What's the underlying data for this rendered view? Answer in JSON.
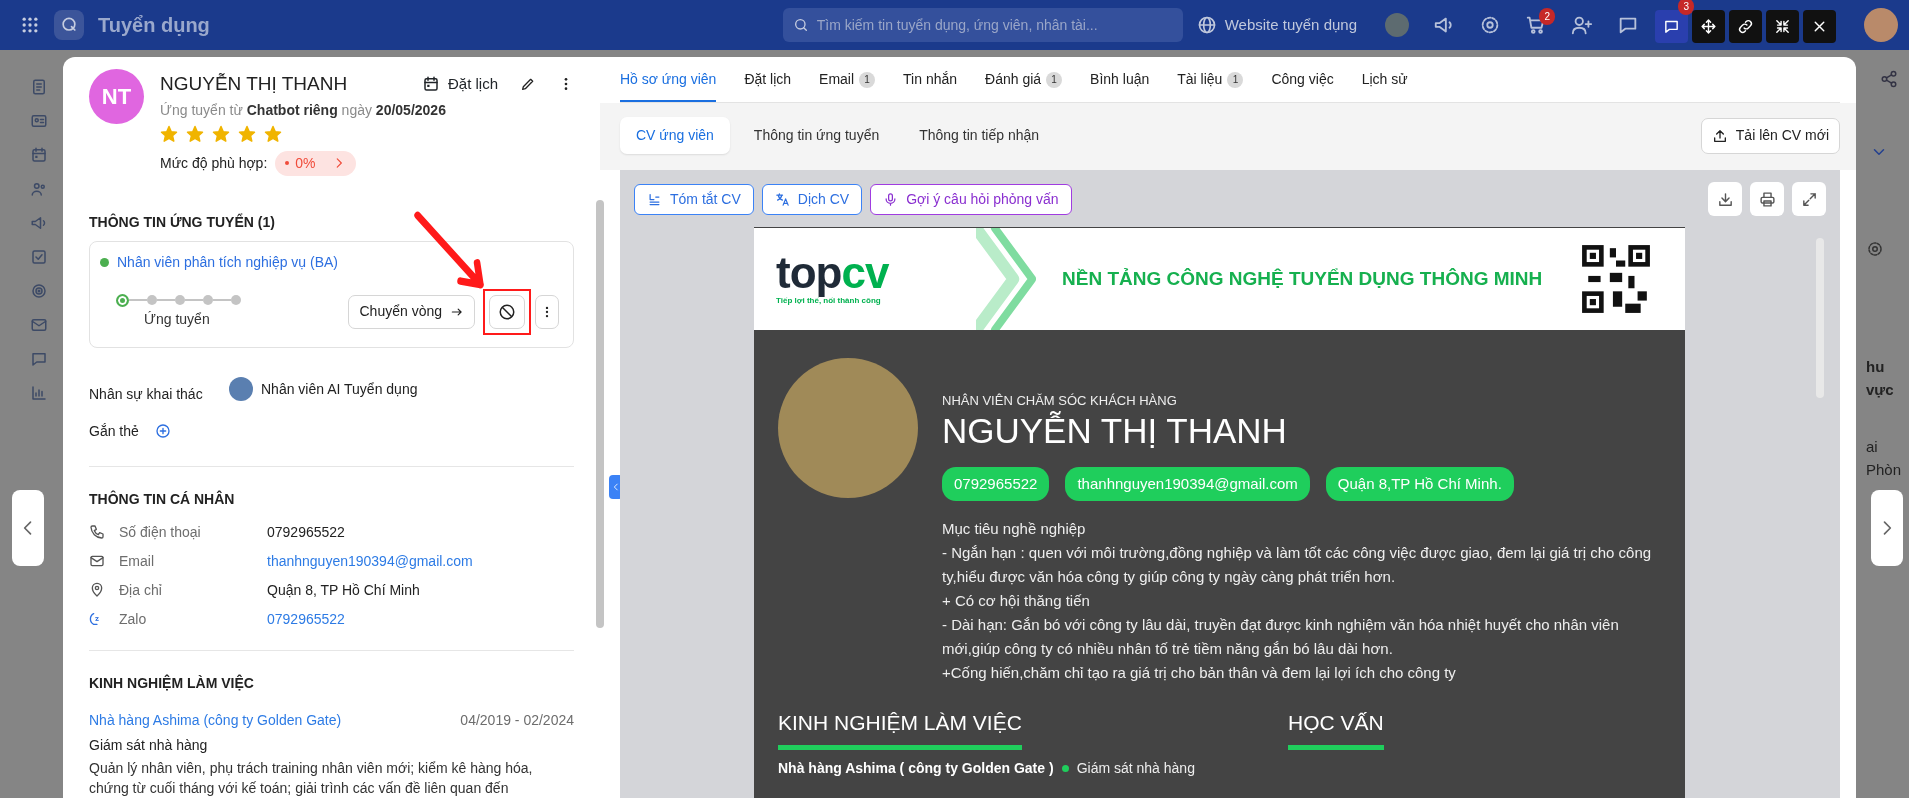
{
  "topbar": {
    "app_title": "Tuyển dụng",
    "search": {
      "placeholder": "Tìm kiếm tin tuyển dụng, ứng viên, nhân tài..."
    },
    "website_link": "Website tuyển dụng",
    "cart_badge": "2"
  },
  "modal_toolbar": {
    "chat_badge": "3"
  },
  "background": {
    "column_header": "hu vực",
    "cell": "ai Phòn"
  },
  "candidate": {
    "initials": "NT",
    "name": "NGUYỄN THỊ THANH",
    "schedule_button": "Đặt lịch",
    "source": "Ứng tuyển từ **Chatbot riêng** ngày **20/05/2026**",
    "stars": 5,
    "match_label": "Mức độ phù hợp:",
    "match_value": "0%"
  },
  "application": {
    "title": "THÔNG TIN ỨNG TUYỂN (1)",
    "job": {
      "title": "Nhân viên phân tích nghiệp vụ (BA)",
      "color": "#4caf50"
    },
    "stages": [
      {
        "selected": true
      },
      {
        "selected": false
      },
      {
        "selected": false
      },
      {
        "selected": false
      },
      {
        "selected": false
      }
    ],
    "current_stage": "Ứng tuyển",
    "move_button": "Chuyển vòng",
    "owner_label": "Nhân sự khai thác",
    "owner_name": "Nhân viên AI Tuyển dụng",
    "tag_label": "Gắn thẻ"
  },
  "personal": {
    "title": "THÔNG TIN CÁ NHÂN",
    "fields": [
      {
        "kind": "phone",
        "label": "Số điện thoại",
        "value": "0792965522",
        "link": false
      },
      {
        "kind": "email",
        "label": "Email",
        "value": "thanhnguyen190394@gmail.com",
        "link": true
      },
      {
        "kind": "address",
        "label": "Địa chỉ",
        "value": "Quận 8, TP Hồ Chí Minh",
        "link": false
      },
      {
        "kind": "zalo",
        "label": "Zalo",
        "value": "0792965522",
        "link": true
      }
    ]
  },
  "experience": {
    "title": "KINH NGHIỆM LÀM VIỆC",
    "items": [
      {
        "company": "Nhà hàng Ashima (công ty Golden Gate)",
        "period": "04/2019 - 02/2024",
        "role": "Giám sát nhà hàng",
        "description": "Quản lý nhân viên, phụ trách training nhân viên mới; kiểm kê hàng hóa, chứng từ cuối tháng với kế toán; giải trình các vấn đề liên quan đến"
      }
    ]
  },
  "tabs": [
    {
      "label": "Hồ sơ ứng viên",
      "selected": true
    },
    {
      "label": "Đặt lịch",
      "selected": false
    },
    {
      "label": "Email",
      "count": "1",
      "selected": false
    },
    {
      "label": "Tin nhắn",
      "selected": false
    },
    {
      "label": "Đánh giá",
      "count": "1",
      "selected": false
    },
    {
      "label": "Bình luận",
      "selected": false
    },
    {
      "label": "Tài liệu",
      "count": "1",
      "selected": false
    },
    {
      "label": "Công việc",
      "selected": false
    },
    {
      "label": "Lịch sử",
      "selected": false
    }
  ],
  "subtabs": [
    {
      "label": "CV ứng viên",
      "selected": true
    },
    {
      "label": "Thông tin ứng tuyển",
      "selected": false
    },
    {
      "label": "Thông tin tiếp nhận",
      "selected": false
    }
  ],
  "upload_button": "Tải lên CV mới",
  "cv_tools": [
    {
      "kind": "summary",
      "label": "Tóm tắt CV"
    },
    {
      "kind": "translate",
      "label": "Dịch CV"
    },
    {
      "kind": "questions",
      "label": "Gợi ý câu hỏi phỏng vấn"
    }
  ],
  "cv": {
    "banner": {
      "logo_dark": "top",
      "logo_accent": "cv",
      "tagline": "Tiếp lợi thế, nối thành công",
      "headline": "NỀN TẢNG CÔNG NGHỆ TUYỂN DỤNG THÔNG MINH"
    },
    "position": "NHÂN VIÊN CHĂM SÓC KHÁCH HÀNG",
    "name": "NGUYỄN THỊ THANH",
    "contacts": [
      "0792965522",
      "thanhnguyen190394@gmail.com",
      "Quận 8,TP Hồ Chí Minh."
    ],
    "objective": [
      "Mục tiêu nghề nghiệp",
      "- Ngắn hạn : quen với môi trường,đồng nghiệp và làm tốt các công việc được giao, đem lại giá trị cho công ty,hiểu được văn hóa công ty giúp công ty ngày càng phát triển hơn.",
      "+ Có cơ hội thăng tiến",
      "- Dài hạn: Gắn bó với công ty lâu dài, truyền đạt được kinh nghiệm văn hóa nhiệt huyết cho nhân viên mới,giúp công ty có nhiều nhân tố trẻ tiềm năng gắn bó lâu dài hơn.",
      "+Cống hiến,chăm chỉ tạo ra giá trị cho bản thân và đem lại lợi ích cho công ty"
    ],
    "experience_title": "KINH NGHIỆM LÀM VIỆC",
    "education_title": "HỌC VẤN",
    "experience_row": {
      "company": "Nhà hàng Ashima ( công ty Golden Gate )",
      "role": "Giám sát nhà hàng"
    }
  }
}
